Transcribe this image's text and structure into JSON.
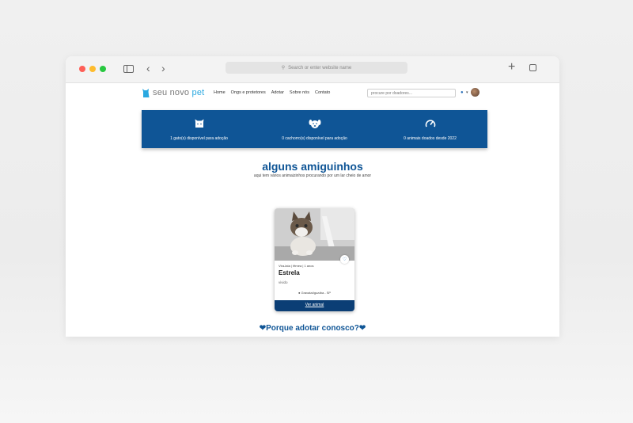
{
  "browser": {
    "url_placeholder": "Search or enter website name"
  },
  "site": {
    "logo_text_a": "seu novo",
    "logo_text_b": "pet",
    "nav": [
      "Home",
      "Ongs e protetores",
      "Adotar",
      "Sobre nós",
      "Contato"
    ],
    "search_placeholder": "procure por doadores..."
  },
  "stats": [
    {
      "icon": "cat-icon",
      "label": "1 gato(s) disponível para adoção"
    },
    {
      "icon": "dog-icon",
      "label": "0 cachorro(s) disponível para adoção"
    },
    {
      "icon": "gauge-icon",
      "label": "0 animais doados desde 2022"
    }
  ],
  "section": {
    "title": "alguns amiguinhos",
    "subtitle": "aqui tem vários animaizinhos procurando por um lar cheio de amor"
  },
  "card": {
    "meta": "Vira-lata | fêmea | 1 anos",
    "name": "Estrela",
    "gender": "vivido",
    "location": "Gravataí/guaíba - SP",
    "button": "Ver animal"
  },
  "why": {
    "title": "Porque adotar conosco?"
  },
  "colors": {
    "primary": "#0f5596",
    "button": "#0b3e75",
    "logo_accent": "#2aa8e0"
  }
}
